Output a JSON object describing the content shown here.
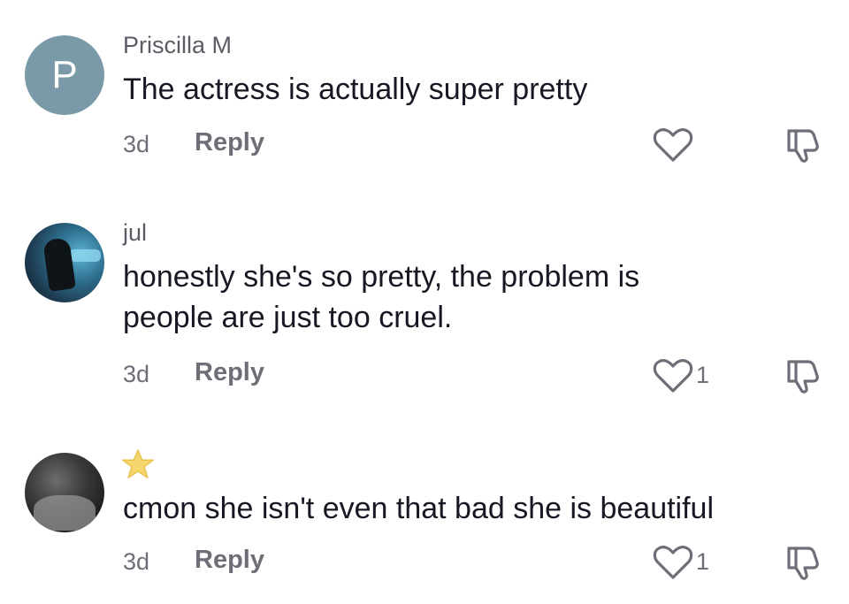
{
  "comments": [
    {
      "avatar_letter": "P",
      "username": "Priscilla M",
      "text": "The actress is actually super pretty",
      "time": "3d",
      "reply_label": "Reply",
      "like_count": ""
    },
    {
      "username": "jul",
      "text_line1": "honestly she's so pretty, the problem is",
      "text_line2": "people are just too cruel.",
      "time": "3d",
      "reply_label": "Reply",
      "like_count": "1"
    },
    {
      "username_icon": "star-icon",
      "text": "cmon she isn't even that bad she is beautiful",
      "time": "3d",
      "reply_label": "Reply",
      "like_count": "1"
    }
  ],
  "icons": {
    "like": "heart-outline-icon",
    "dislike": "thumbs-down-outline-icon"
  },
  "colors": {
    "text": "#161823",
    "muted": "#6e6e78",
    "avatar_p": "#7a9aa8",
    "star": "#f5d76e"
  }
}
